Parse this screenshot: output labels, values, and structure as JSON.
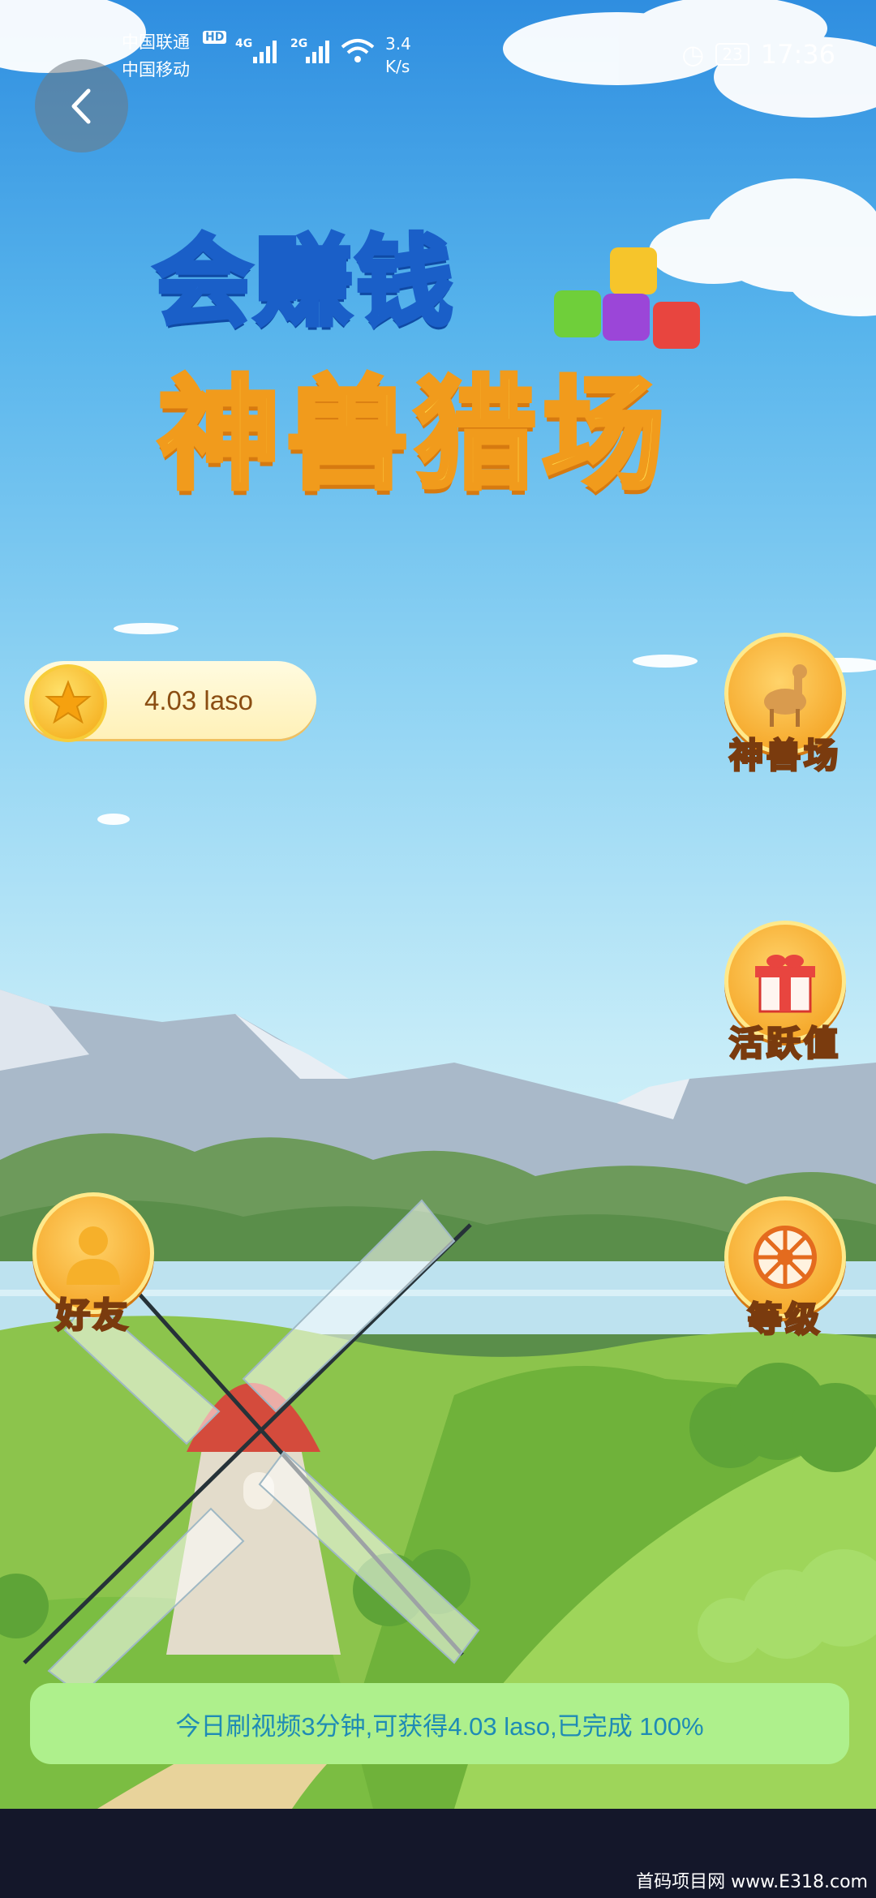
{
  "status_bar": {
    "carrier_1": "中国联通",
    "carrier_2": "中国移动",
    "hd": "HD",
    "network_1": "4G",
    "network_2": "2G",
    "speed_value": "3.4",
    "speed_unit": "K/s",
    "battery": "23",
    "time": "17:36"
  },
  "title": {
    "line1": "会赚钱",
    "line2": "神兽猎场"
  },
  "balance": {
    "text": "4.03 laso"
  },
  "menu": {
    "beast_field": "神兽场",
    "activity": "活跃值",
    "friends": "好友",
    "level": "等级"
  },
  "progress": {
    "text": "今日刷视频3分钟,可获得4.03 laso,已完成 100%"
  },
  "watermark": {
    "text": "首码项目网 www.E318.com"
  },
  "icons": [
    "back-arrow-icon",
    "wifi-icon",
    "signal-icon",
    "alarm-icon",
    "battery-icon",
    "star-coin-icon",
    "deer-icon",
    "gift-icon",
    "person-icon",
    "wheel-icon",
    "windmill-icon"
  ]
}
